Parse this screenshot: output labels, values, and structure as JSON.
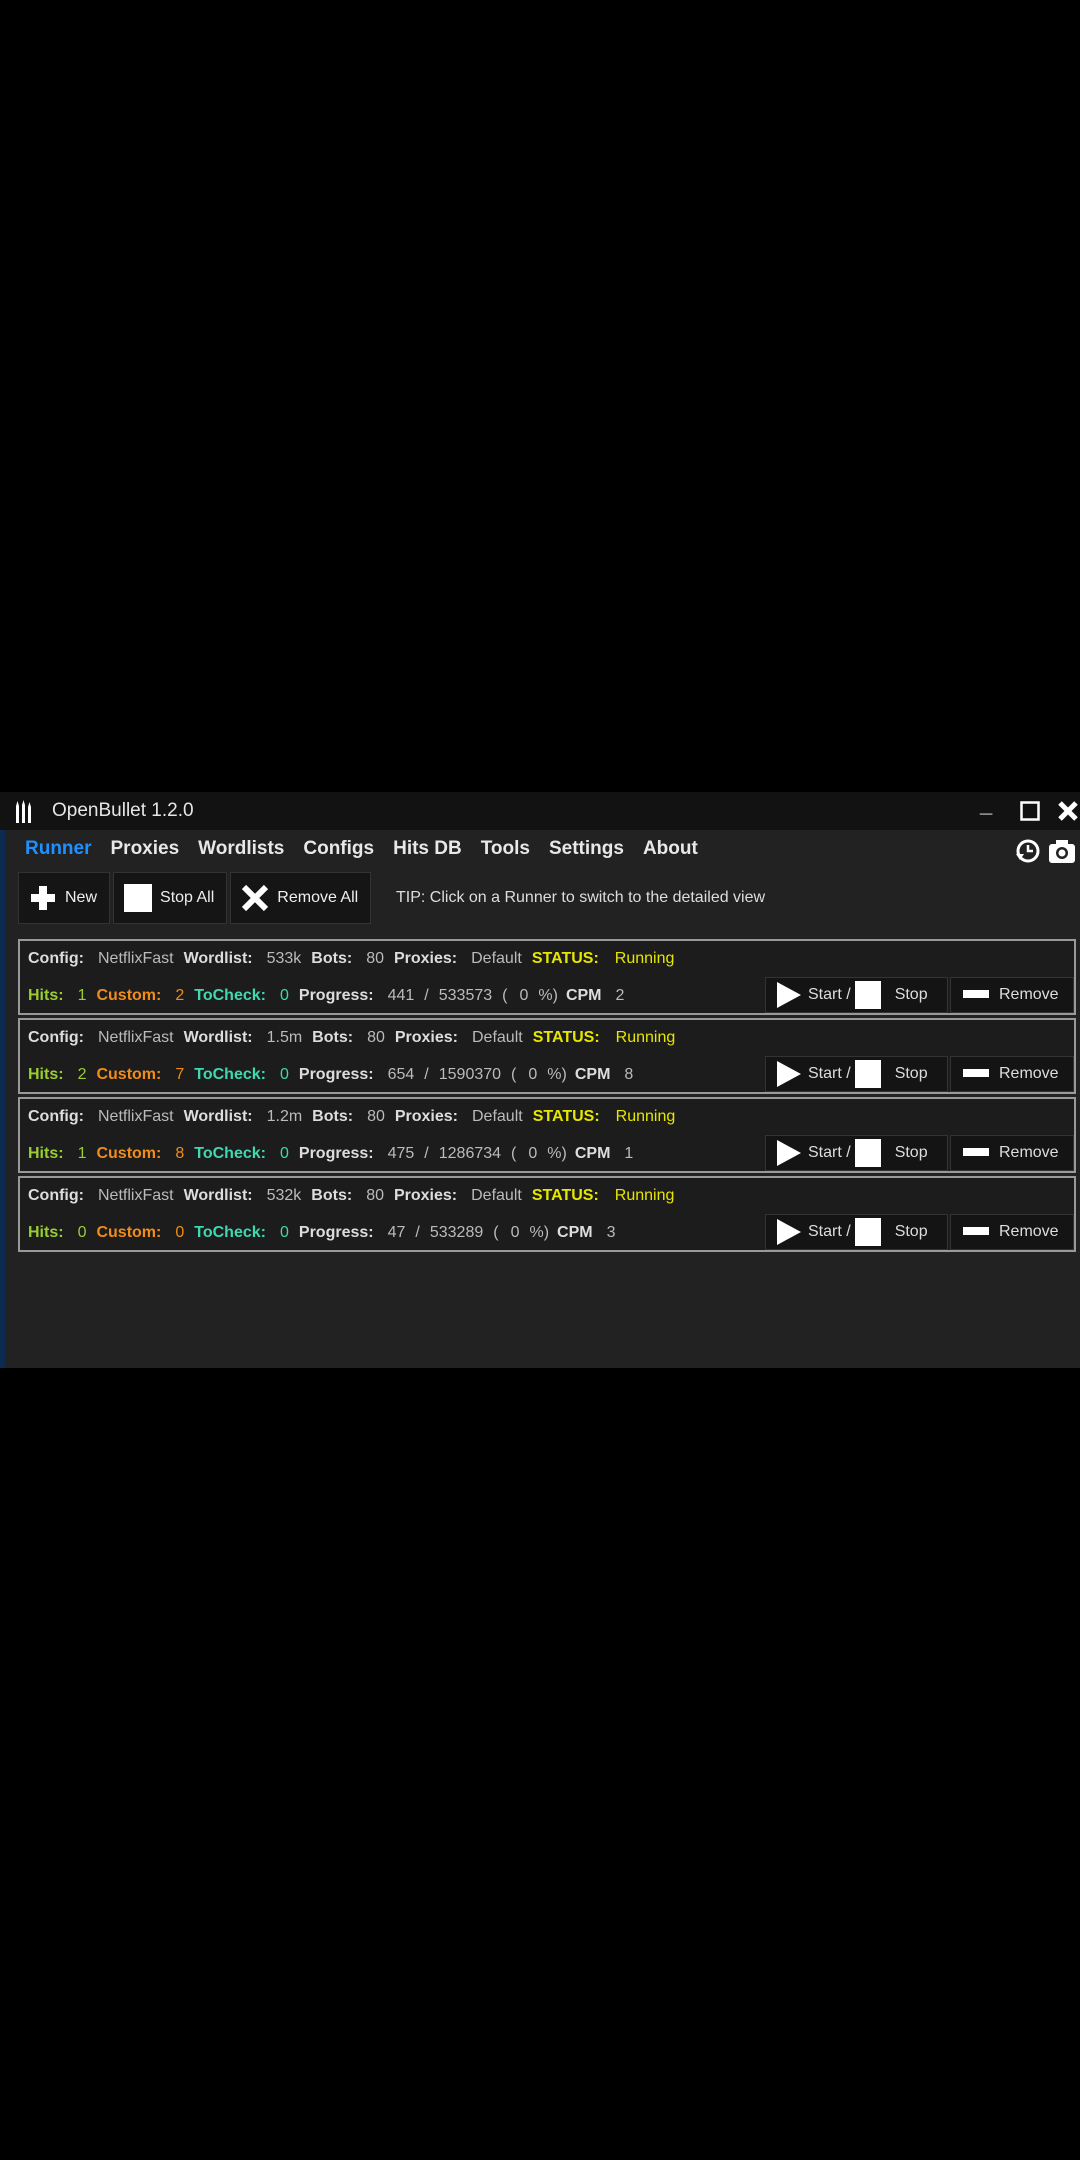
{
  "window": {
    "title": "OpenBullet 1.2.0"
  },
  "menu": [
    {
      "label": "Runner",
      "active": true
    },
    {
      "label": "Proxies"
    },
    {
      "label": "Wordlists"
    },
    {
      "label": "Configs"
    },
    {
      "label": "Hits DB"
    },
    {
      "label": "Tools"
    },
    {
      "label": "Settings"
    },
    {
      "label": "About"
    }
  ],
  "toolbar": {
    "new_label": "New",
    "stop_all_label": "Stop All",
    "remove_all_label": "Remove All"
  },
  "tip": "TIP: Click on a Runner to switch to the detailed view",
  "labels": {
    "config": "Config:",
    "wordlist": "Wordlist:",
    "bots": "Bots:",
    "proxies": "Proxies:",
    "status": "STATUS:",
    "hits": "Hits:",
    "custom": "Custom:",
    "tocheck": "ToCheck:",
    "progress": "Progress:",
    "cpm": "CPM",
    "start": "Start /",
    "stop": "Stop",
    "remove": "Remove"
  },
  "runners": [
    {
      "config": "NetflixFast",
      "wordlist": "533k",
      "bots": "80",
      "proxies": "Default",
      "status": "Running",
      "hits": "1",
      "custom": "2",
      "tocheck": "0",
      "done": "441",
      "total": "533573",
      "percent": "0",
      "cpm": "2"
    },
    {
      "config": "NetflixFast",
      "wordlist": "1.5m",
      "bots": "80",
      "proxies": "Default",
      "status": "Running",
      "hits": "2",
      "custom": "7",
      "tocheck": "0",
      "done": "654",
      "total": "1590370",
      "percent": "0",
      "cpm": "8"
    },
    {
      "config": "NetflixFast",
      "wordlist": "1.2m",
      "bots": "80",
      "proxies": "Default",
      "status": "Running",
      "hits": "1",
      "custom": "8",
      "tocheck": "0",
      "done": "475",
      "total": "1286734",
      "percent": "0",
      "cpm": "1"
    },
    {
      "config": "NetflixFast",
      "wordlist": "532k",
      "bots": "80",
      "proxies": "Default",
      "status": "Running",
      "hits": "0",
      "custom": "0",
      "tocheck": "0",
      "done": "47",
      "total": "533289",
      "percent": "0",
      "cpm": "3"
    }
  ],
  "colors": {
    "accent": "#1e90ff",
    "hits": "#9acd32",
    "custom": "#f08c1a",
    "tocheck": "#3fd8b0",
    "status": "#e6e600"
  }
}
